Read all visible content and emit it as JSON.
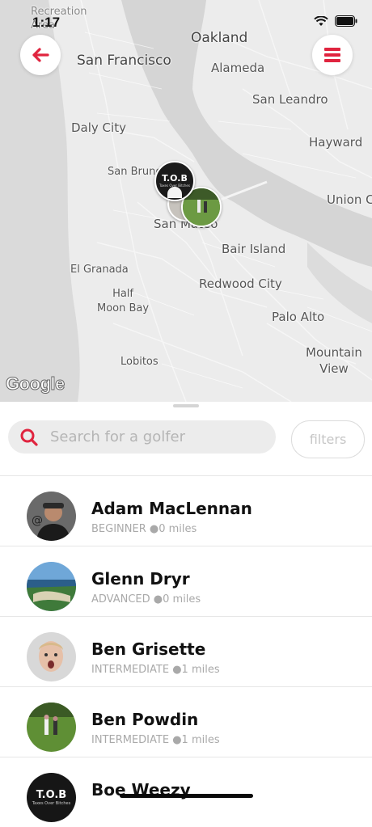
{
  "status_bar": {
    "time": "1:17"
  },
  "map": {
    "labels": {
      "recreation_area": "Recreation\nArea",
      "oakland": "Oakland",
      "san_francisco": "San Francisco",
      "alameda": "Alameda",
      "san_leandro": "San Leandro",
      "daly_city": "Daly City",
      "hayward": "Hayward",
      "san_bruno": "San Bruno",
      "union_city": "Union C",
      "san_mateo": "San Mateo",
      "bair_island": "Bair Island",
      "el_granada": "El Granada",
      "redwood_city": "Redwood City",
      "half_moon_bay": "Half\nMoon Bay",
      "palo_alto": "Palo Alto",
      "mountain_view": "Mountain\nView",
      "lobitos": "Lobitos"
    },
    "attribution": "Google",
    "pin_tob_text": "T.O.B",
    "pin_tob_sub": "Taxes Over Bitches"
  },
  "search": {
    "placeholder": "Search for a golfer",
    "filters_label": "filters"
  },
  "golfers": [
    {
      "name": "Adam MacLennan",
      "meta": "BEGINNER ●0 miles"
    },
    {
      "name": "Glenn Dryr",
      "meta": "ADVANCED ●0 miles"
    },
    {
      "name": "Ben Grisette",
      "meta": "INTERMEDIATE ●1 miles"
    },
    {
      "name": "Ben Powdin",
      "meta": "INTERMEDIATE ●1 miles"
    },
    {
      "name": "Boe Weezy",
      "meta": ""
    }
  ],
  "colors": {
    "accent": "#e0243f",
    "map_water": "#d9d9d9",
    "map_land": "#efefef"
  },
  "icons": {
    "back": "arrow-left-icon",
    "menu": "menu-icon",
    "search": "search-icon"
  }
}
